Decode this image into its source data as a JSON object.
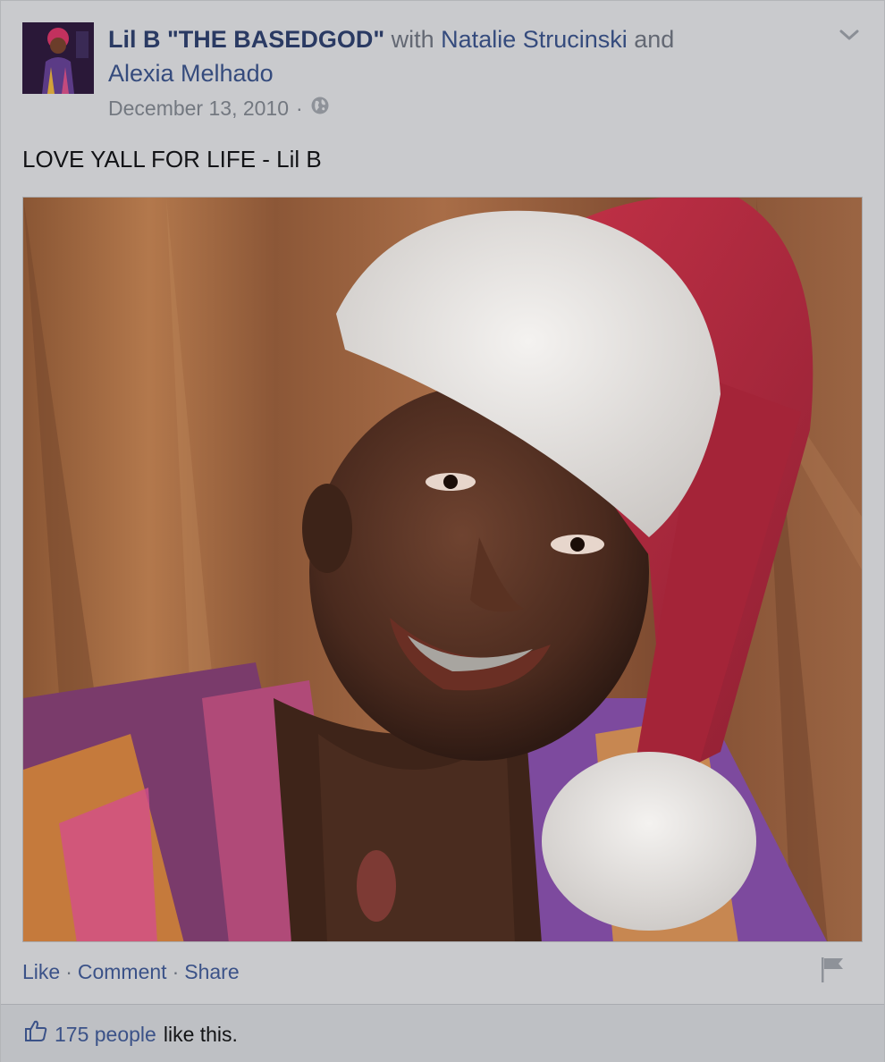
{
  "post": {
    "author": "Lil B \"THE BASEDGOD\"",
    "with_text": "with",
    "tagged_1": "Natalie Strucinski",
    "and_text": "and",
    "tagged_2": "Alexia Melhado",
    "date": "December 13, 2010",
    "date_separator": "·",
    "privacy_icon": "globe-icon",
    "menu_icon": "chevron-down-icon",
    "status_text": "LOVE YALL FOR LIFE - Lil B"
  },
  "actions": {
    "like": "Like",
    "comment": "Comment",
    "share": "Share",
    "separator": "·",
    "report_icon": "flag-icon"
  },
  "likes": {
    "icon": "thumbs-up-icon",
    "count": "175 people",
    "suffix": "like this."
  },
  "colors": {
    "link": "#3b5288",
    "author": "#2a3a63",
    "background": "#c9cacd",
    "santa_hat_red": "#b8233e"
  }
}
